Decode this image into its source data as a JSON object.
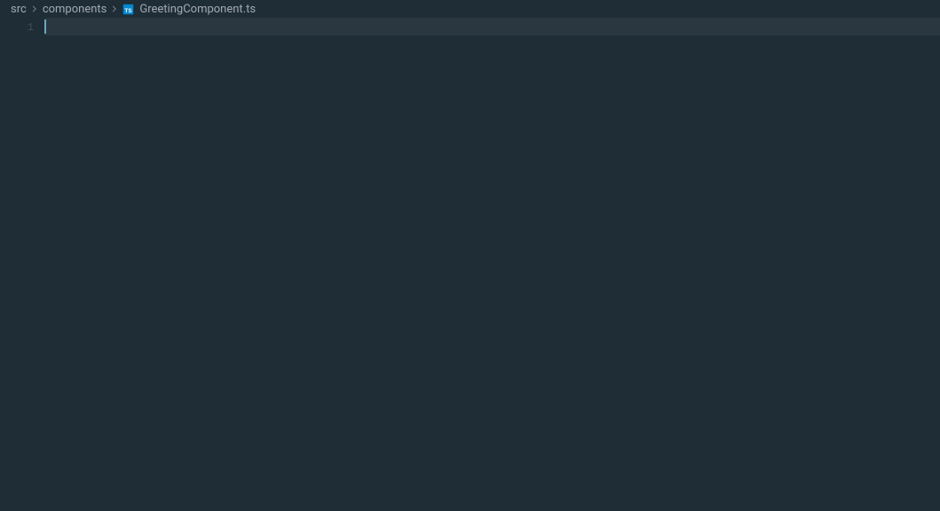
{
  "breadcrumb": {
    "segments": [
      "src",
      "components",
      "GreetingComponent.ts"
    ]
  },
  "editor": {
    "lines": [
      {
        "number": "1",
        "content": "",
        "active": true
      }
    ]
  },
  "icons": {
    "ts_fill": "#0288d1",
    "ts_letter_color": "#ffffff"
  }
}
